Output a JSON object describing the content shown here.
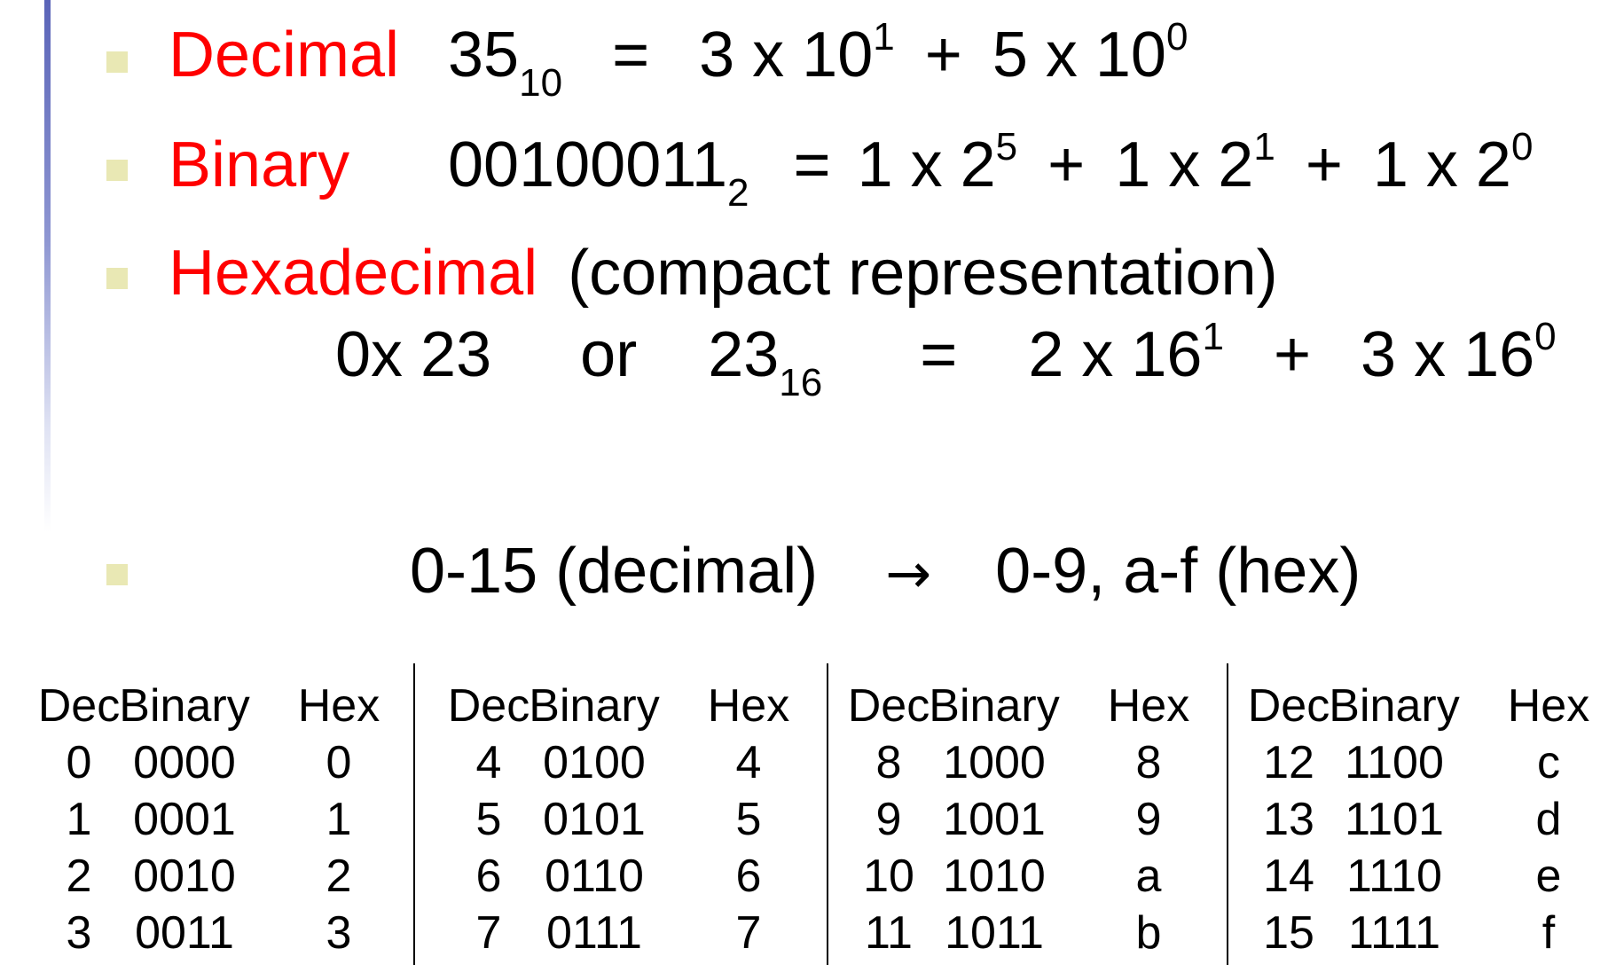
{
  "decimal": {
    "label": "Decimal",
    "number": "35",
    "base": "10",
    "equals": "=",
    "t1": "3 x 10",
    "e1": "1",
    "plus": "+",
    "t2": "5 x 10",
    "e2": "0"
  },
  "binary": {
    "label": "Binary",
    "number": "00100011",
    "base": "2",
    "equals": "=",
    "t1": "1 x 2",
    "e1": "5",
    "plus1": "+",
    "t2": "1 x 2",
    "e2": "1",
    "plus2": "+",
    "t3": "1 x 2",
    "e3": "0"
  },
  "hexadecimal": {
    "label": "Hexadecimal",
    "note": "(compact representation)",
    "prefix_form": "0x 23",
    "or": "or",
    "number": "23",
    "base": "16",
    "equals": "=",
    "t1": "2 x 16",
    "e1": "1",
    "plus": "+",
    "t2": "3 x 16",
    "e2": "0"
  },
  "range": {
    "from": "0-15 (decimal)",
    "arrow": "→",
    "to": "0-9, a-f  (hex)"
  },
  "table": {
    "headers": [
      "Dec",
      "Binary",
      "Hex"
    ],
    "groups": [
      [
        [
          "0",
          "0000",
          "0"
        ],
        [
          "1",
          "0001",
          "1"
        ],
        [
          "2",
          "0010",
          "2"
        ],
        [
          "3",
          "0011",
          "3"
        ]
      ],
      [
        [
          "4",
          "0100",
          "4"
        ],
        [
          "5",
          "0101",
          "5"
        ],
        [
          "6",
          "0110",
          "6"
        ],
        [
          "7",
          "0111",
          "7"
        ]
      ],
      [
        [
          "8",
          "1000",
          "8"
        ],
        [
          "9",
          "1001",
          "9"
        ],
        [
          "10",
          "1010",
          "a"
        ],
        [
          "11",
          "1011",
          "b"
        ]
      ],
      [
        [
          "12",
          "1100",
          "c"
        ],
        [
          "13",
          "1101",
          "d"
        ],
        [
          "14",
          "1110",
          "e"
        ],
        [
          "15",
          "1111",
          "f"
        ]
      ]
    ]
  }
}
